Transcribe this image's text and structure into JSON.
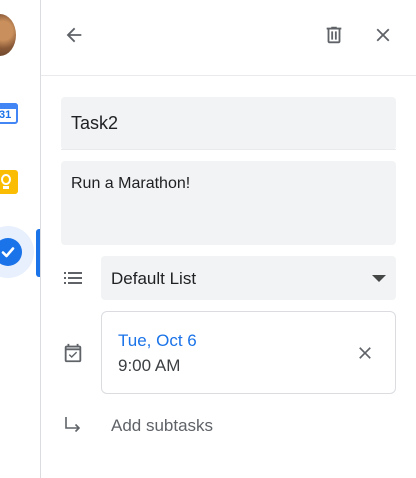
{
  "rail": {
    "apps": [
      {
        "name": "calendar",
        "icon": "calendar-icon",
        "badge": "31"
      },
      {
        "name": "keep",
        "icon": "keep-icon"
      },
      {
        "name": "tasks",
        "icon": "tasks-icon",
        "active": true
      }
    ]
  },
  "toolbar": {
    "back_icon": "arrow-back-icon",
    "delete_icon": "trash-icon",
    "close_icon": "close-icon"
  },
  "task": {
    "title": "Task2",
    "details": "Run a Marathon!",
    "list": "Default List",
    "date": "Tue, Oct 6",
    "time": "9:00 AM",
    "add_subtasks_label": "Add subtasks"
  },
  "colors": {
    "accent": "#1a73e8",
    "field_bg": "#f1f3f4",
    "icon": "#5f6368"
  }
}
